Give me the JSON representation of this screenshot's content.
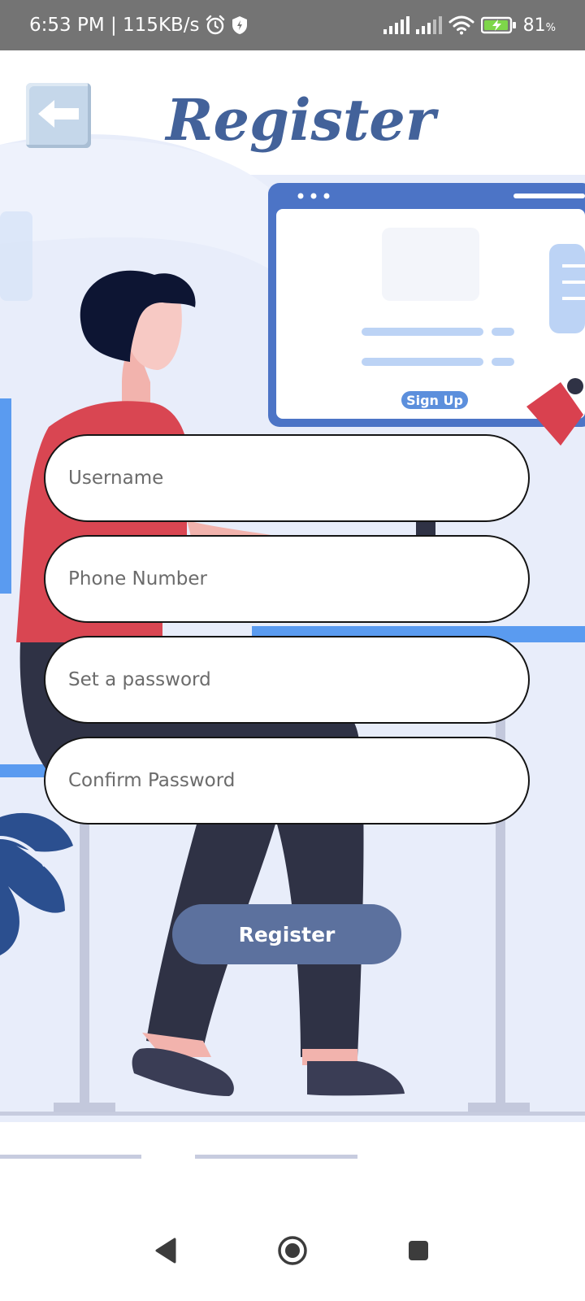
{
  "status_bar": {
    "time_speed": "6:53 PM | 115KB/s",
    "battery_percent": "81",
    "battery_unit": "%",
    "icons": [
      "alarm-icon",
      "shield-icon",
      "signal-icon",
      "signal-icon",
      "wifi-icon",
      "battery-charging-icon"
    ]
  },
  "header": {
    "back_icon": "left-arrow-icon",
    "title": "Register"
  },
  "illustration": {
    "signup_badge": "Sign Up"
  },
  "form": {
    "username_placeholder": "Username",
    "phone_placeholder": "Phone Number",
    "password_placeholder": "Set a password",
    "confirm_placeholder": "Confirm Password",
    "submit_label": "Register"
  },
  "nav": {
    "icons": [
      "back-triangle-icon",
      "home-circle-icon",
      "recents-square-icon"
    ]
  },
  "colors": {
    "title": "#43629a",
    "button": "#5c719e",
    "status_bar": "#747474",
    "shirt": "#d94652",
    "pants": "#2f3245"
  }
}
